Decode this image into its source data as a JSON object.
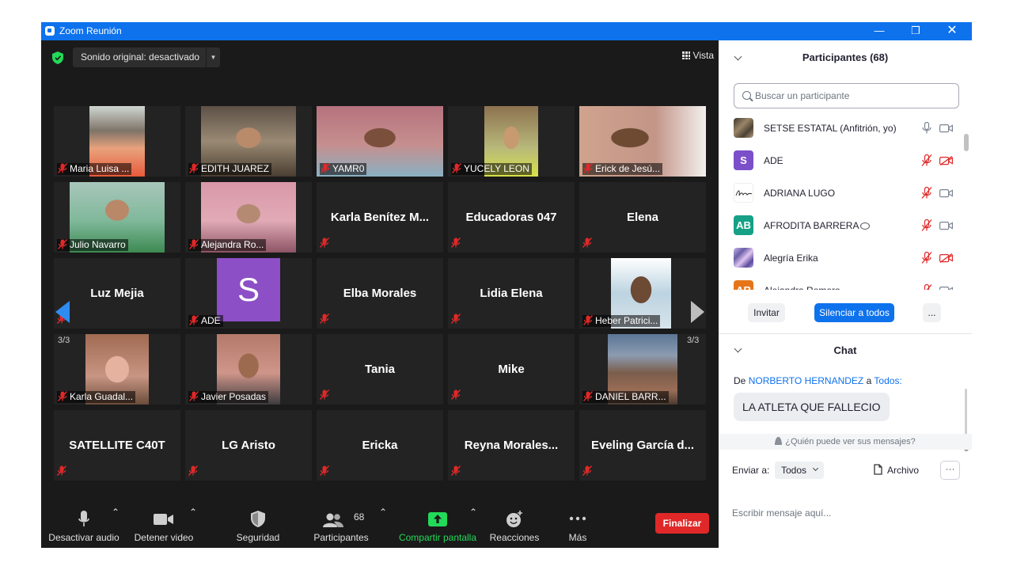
{
  "window": {
    "title": "Zoom Reunión"
  },
  "stage": {
    "audio_label": "Sonido original: desactivado",
    "view_label": "Vista",
    "page_indicator": "3/3",
    "tiles": [
      {
        "label": "Maria Luisa ...",
        "type": "video"
      },
      {
        "label": "EDITH JUAREZ",
        "type": "video"
      },
      {
        "label": "YAMR0",
        "type": "video"
      },
      {
        "label": "YUCELY LEON",
        "type": "video"
      },
      {
        "label": "Erick de Jesú...",
        "type": "video"
      },
      {
        "label": "Julio Navarro",
        "type": "video"
      },
      {
        "label": "Alejandra Ro...",
        "type": "video"
      },
      {
        "label": "Karla  Benítez  M...",
        "type": "name"
      },
      {
        "label": "Educadoras 047",
        "type": "name"
      },
      {
        "label": "Elena",
        "type": "name"
      },
      {
        "label": "Luz Mejia",
        "type": "name"
      },
      {
        "label": "ADE",
        "type": "avatar",
        "initial": "S"
      },
      {
        "label": "Elba Morales",
        "type": "name"
      },
      {
        "label": "Lidia Elena",
        "type": "name"
      },
      {
        "label": "Heber Patrici...",
        "type": "video"
      },
      {
        "label": "Karla Guadal...",
        "type": "video"
      },
      {
        "label": "Javier Posadas",
        "type": "video"
      },
      {
        "label": "Tania",
        "type": "name"
      },
      {
        "label": "Mike",
        "type": "name"
      },
      {
        "label": "DANIEL BARR...",
        "type": "video"
      },
      {
        "label": "SATELLITE C40T",
        "type": "name"
      },
      {
        "label": "LG Aristo",
        "type": "name"
      },
      {
        "label": "Ericka",
        "type": "name"
      },
      {
        "label": "Reyna  Morales...",
        "type": "name"
      },
      {
        "label": "Eveling  García  d...",
        "type": "name"
      }
    ]
  },
  "toolbar": {
    "mute": "Desactivar audio",
    "video": "Detener video",
    "security": "Seguridad",
    "participants": "Participantes",
    "participants_count": "68",
    "share": "Compartir pantalla",
    "reactions": "Reacciones",
    "more": "Más",
    "end": "Finalizar"
  },
  "participants_panel": {
    "title": "Participantes (68)",
    "search_placeholder": "Buscar un participante",
    "list": [
      {
        "name": "SETSE ESTATAL (Anfitrión, yo)",
        "initials": "",
        "color": "#6b5a48"
      },
      {
        "name": "ADE",
        "initials": "S",
        "color": "#7b4fc9"
      },
      {
        "name": "ADRIANA LUGO",
        "initials": "",
        "color": "#ffffff"
      },
      {
        "name": "AFRODITA  BARRERA",
        "initials": "AB",
        "color": "#16a085"
      },
      {
        "name": "Alegría Erika",
        "initials": "",
        "color": "#8e7cc3"
      },
      {
        "name": "Alejandra Romero",
        "initials": "AR",
        "color": "#e6751a"
      }
    ],
    "invite": "Invitar",
    "mute_all": "Silenciar a todos",
    "more": "..."
  },
  "chat_panel": {
    "title": "Chat",
    "from_prefix": "De",
    "from_name": "NORBERTO HERNANDEZ",
    "to_word": "a",
    "to_name": "Todos:",
    "message": "LA ATLETA QUE FALLECIO",
    "who_can_see": "¿Quién puede ver sus mensajes?",
    "send_to_label": "Enviar a:",
    "send_to_value": "Todos",
    "file_label": "Archivo",
    "more": "···",
    "compose_placeholder": "Escribir mensaje aquí..."
  }
}
